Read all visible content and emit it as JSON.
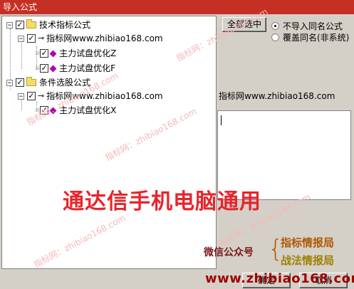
{
  "window": {
    "title": "导入公式"
  },
  "tree": {
    "root1": {
      "label": "技术指标公式",
      "checked": true
    },
    "src1": {
      "label": "指标网www.zhibiao168.com",
      "checked": true
    },
    "formulas1": [
      {
        "label": "主力试盘优化Z",
        "checked": true
      },
      {
        "label": "主力试盘优化F",
        "checked": true
      }
    ],
    "root2": {
      "label": "条件选股公式",
      "checked": true
    },
    "src2": {
      "label": "指标网www.zhibiao168.com",
      "checked": true
    },
    "formulas2": [
      {
        "label": "主力试盘优化X",
        "checked": true
      }
    ]
  },
  "buttons": {
    "select_all": "全部选中",
    "ok": "确定",
    "cancel": "取消"
  },
  "options": {
    "no_import": "不导入同名公式",
    "overwrite": "覆盖同名(非系统)",
    "selected": "no_import"
  },
  "info": {
    "source": "指标网www.zhibiao168.com"
  },
  "overlay": {
    "big_text": "通达信手机电脑通用",
    "wechat": "微信公众号",
    "acct1": "指标情报局",
    "acct2": "战法情报局",
    "url": "www.zhibiao168.com",
    "watermark": "指标网：zhibiao168.com"
  },
  "colors": {
    "title_bg": "#c62f24",
    "overlay_red": "#e8242b",
    "acct1": "#b05800",
    "acct2": "#a08000",
    "wechat": "#7a1a1a",
    "url": "#a00000"
  }
}
